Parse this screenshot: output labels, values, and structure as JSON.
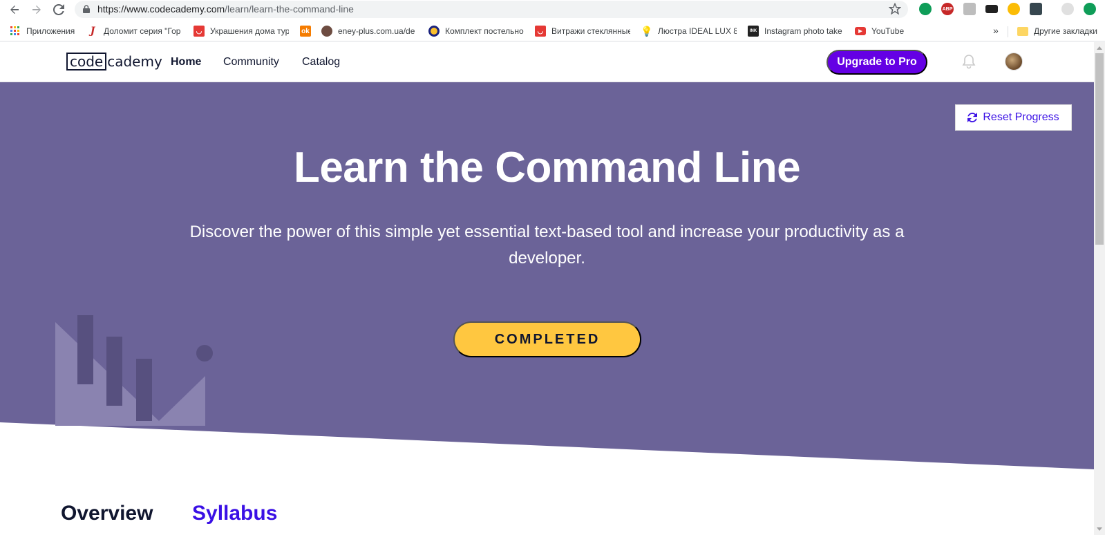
{
  "browser": {
    "url_host": "https://www.codecademy.com",
    "url_path": "/learn/learn-the-command-line",
    "bookmarks": [
      {
        "label": "Приложения",
        "color": "#4285f4",
        "icon": "apps-grid-icon"
      },
      {
        "label": "Доломит серия \"Гор",
        "color": "#c62828",
        "icon": "doc-icon"
      },
      {
        "label": "Украшения дома тур",
        "color": "#e53935",
        "icon": "aliexpress-icon"
      },
      {
        "label": "",
        "color": "#f57c00",
        "icon": "odnoklassniki-icon"
      },
      {
        "label": "eney-plus.com.ua/de",
        "color": "#6d4c41",
        "icon": "eney-icon"
      },
      {
        "label": "Комплект постельно",
        "color": "#1a237e",
        "icon": "circle-icon"
      },
      {
        "label": "Витражи стеклянные",
        "color": "#e53935",
        "icon": "aliexpress-icon"
      },
      {
        "label": "Люстра IDEAL LUX 8",
        "color": "#90caf9",
        "icon": "bulb-icon"
      },
      {
        "label": "Instagram photo take",
        "color": "#222222",
        "icon": "ink361-icon"
      },
      {
        "label": "YouTube",
        "color": "#e53935",
        "icon": "youtube-icon"
      }
    ],
    "other_bookmarks": "Другие закладки",
    "more_bookmarks": "»"
  },
  "header": {
    "logo_box": "code",
    "logo_rest": "cademy",
    "nav": [
      "Home",
      "Community",
      "Catalog"
    ],
    "upgrade_label": "Upgrade to Pro"
  },
  "hero": {
    "reset_label": "Reset Progress",
    "title": "Learn the Command Line",
    "subtitle": "Discover the power of this simple yet essential text-based tool and increase your productivity as a developer.",
    "status_button": "COMPLETED"
  },
  "tabs": {
    "overview": "Overview",
    "syllabus": "Syllabus"
  },
  "colors": {
    "hero_bg": "#6b6398",
    "accent_purple": "#6400e4",
    "link_blue": "#3a10e5",
    "completed_yellow": "#ffc740"
  }
}
